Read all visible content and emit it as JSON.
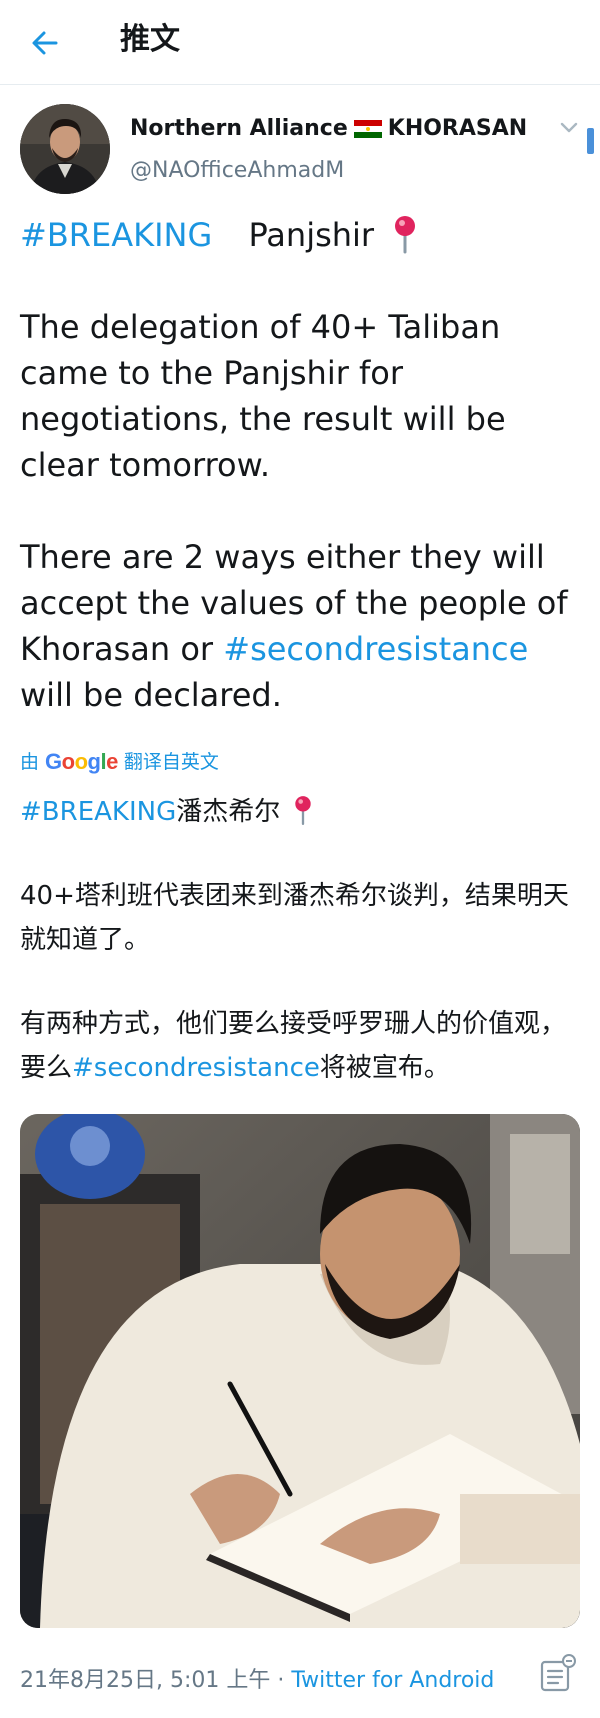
{
  "header": {
    "title": "推文",
    "back_icon": "arrow-left-icon",
    "accent": "#1b95e0"
  },
  "author": {
    "name_part1": "Northern Alliance",
    "name_part2": "KHORASAN",
    "flag_icon": "tajikistan-flag-icon",
    "handle": "@NAOfficeAhmadM",
    "menu_icon": "chevron-down-icon"
  },
  "tweet_en": {
    "hashtag1": "#BREAKING",
    "headline": "Panjshir",
    "pin_icon": "round-pushpin-icon",
    "para1": "The delegation of 40+ Taliban came to the Panjshir for negotiations, the result will be clear tomorrow.",
    "para2_before": "There are 2 ways either they will accept the values of the people of Khorasan or ",
    "hashtag2": "#secondresistance",
    "para2_after": " will be declared."
  },
  "translation": {
    "prefix": "由",
    "provider": "Google",
    "suffix": "翻译自英文"
  },
  "tweet_zh": {
    "hashtag1": "#BREAKING",
    "headline": "潘杰希尔",
    "para1": "40+塔利班代表团来到潘杰希尔谈判，结果明天就知道了。",
    "para2_before": "有两种方式，他们要么接受呼罗珊人的价值观，要么",
    "hashtag2": "#secondresistance",
    "para2_after": "将被宣布。"
  },
  "meta": {
    "timestamp": "21年8月25日, 5:01 上午",
    "separator": " · ",
    "source": "Twitter for Android",
    "stats_icon": "tweet-activity-icon"
  },
  "colors": {
    "link": "#1b95e0",
    "secondary_text": "#657786",
    "primary_text": "#14171a"
  }
}
